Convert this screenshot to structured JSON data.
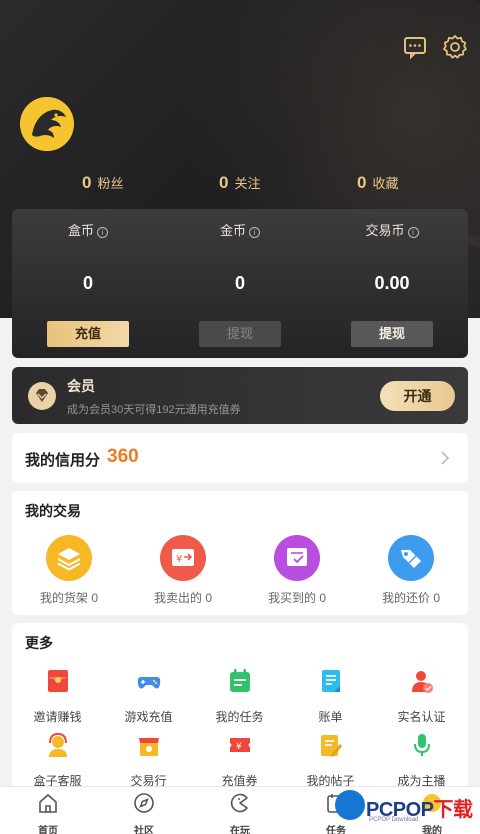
{
  "header": {
    "icons": [
      "message-icon",
      "settings-icon"
    ]
  },
  "stats": [
    {
      "num": "0",
      "label": "粉丝"
    },
    {
      "num": "0",
      "label": "关注"
    },
    {
      "num": "0",
      "label": "收藏"
    }
  ],
  "wallet": [
    {
      "title": "盒币",
      "value": "0",
      "button": "充值"
    },
    {
      "title": "金币",
      "value": "0",
      "button": "提现"
    },
    {
      "title": "交易币",
      "value": "0.00",
      "button": "提现"
    }
  ],
  "vip": {
    "name": "会员",
    "subtitle": "成为会员30天可得192元通用充值券",
    "button": "开通"
  },
  "credit": {
    "label": "我的信用分",
    "score": "360"
  },
  "trade": {
    "title": "我的交易",
    "items": [
      {
        "label": "我的货架 0",
        "icon": "layers-icon",
        "color": "#f6b824"
      },
      {
        "label": "我卖出的 0",
        "icon": "sold-icon",
        "color": "#f05a4a"
      },
      {
        "label": "我买到的 0",
        "icon": "bought-icon",
        "color": "#b84de0"
      },
      {
        "label": "我的还价 0",
        "icon": "tag-icon",
        "color": "#3d9bf0"
      }
    ]
  },
  "more": {
    "title": "更多",
    "items": [
      {
        "label": "邀请赚钱",
        "icon": "red-envelope-icon",
        "color": "#f0473b"
      },
      {
        "label": "游戏充值",
        "icon": "gamepad-icon",
        "color": "#3d8ef0"
      },
      {
        "label": "我的任务",
        "icon": "task-calendar-icon",
        "color": "#2fc46a"
      },
      {
        "label": "账单",
        "icon": "bill-icon",
        "color": "#2cbcf0"
      },
      {
        "label": "实名认证",
        "icon": "verified-user-icon",
        "color": "#f0473b"
      },
      {
        "label": "盒子客服",
        "icon": "customer-service-icon",
        "color": "#f6b824"
      },
      {
        "label": "交易行",
        "icon": "shop-icon",
        "color": "#f6b824"
      },
      {
        "label": "充值券",
        "icon": "coupon-icon",
        "color": "#f0473b"
      },
      {
        "label": "我的帖子",
        "icon": "post-edit-icon",
        "color": "#f6b824"
      },
      {
        "label": "成为主播",
        "icon": "microphone-icon",
        "color": "#2fc46a"
      }
    ]
  },
  "tabs": [
    {
      "label": "首页",
      "icon": "home-icon"
    },
    {
      "label": "社区",
      "icon": "compass-icon"
    },
    {
      "label": "在玩",
      "icon": "gamepad-tab-icon"
    },
    {
      "label": "任务",
      "icon": "calendar-icon"
    },
    {
      "label": "我的",
      "icon": "profile-icon"
    }
  ],
  "watermark": {
    "brand": "PCPOP",
    "brand_suffix": "下载",
    "sub": "PCPOP Download"
  }
}
